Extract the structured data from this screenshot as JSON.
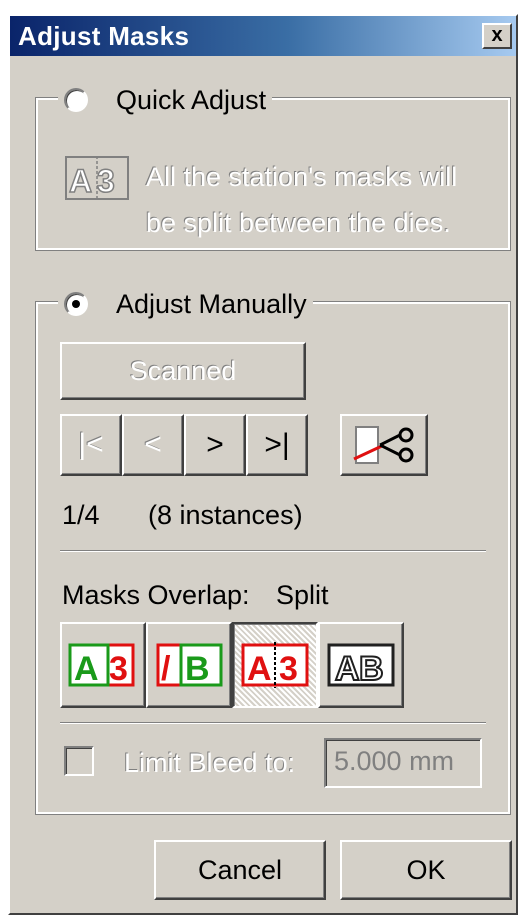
{
  "window": {
    "title": "Adjust Masks",
    "close_label": "x"
  },
  "quick_adjust": {
    "label": "Quick Adjust",
    "selected": false,
    "description_line1": "All the station's masks will",
    "description_line2": "be split between the dies.",
    "icon": "ab-split-icon"
  },
  "adjust_manually": {
    "label": "Adjust Manually",
    "selected": true,
    "scanned_label": "Scanned",
    "nav": {
      "first": "|<",
      "prev": "<",
      "next": ">",
      "last": ">|"
    },
    "scissors_icon": "scissors-cut-icon",
    "position_text": "1/4",
    "instances_text": "(8 instances)",
    "overlap_label": "Masks Overlap:",
    "overlap_value": "Split",
    "overlap_options": [
      {
        "name": "left-a-over",
        "icon": "mask-a-over-b-icon"
      },
      {
        "name": "right-b-over",
        "icon": "mask-b-over-a-icon"
      },
      {
        "name": "split",
        "icon": "mask-split-icon",
        "selected": true
      },
      {
        "name": "merge",
        "icon": "mask-merge-icon"
      }
    ],
    "limit_bleed_label": "Limit Bleed to:",
    "limit_bleed_checked": false,
    "limit_bleed_value": "5.000 mm"
  },
  "buttons": {
    "cancel": "Cancel",
    "ok": "OK"
  },
  "colors": {
    "title_start": "#0a246a",
    "title_end": "#a6caf0",
    "face": "#d4d0c8",
    "green": "#1a9a1a",
    "red": "#e01010"
  }
}
